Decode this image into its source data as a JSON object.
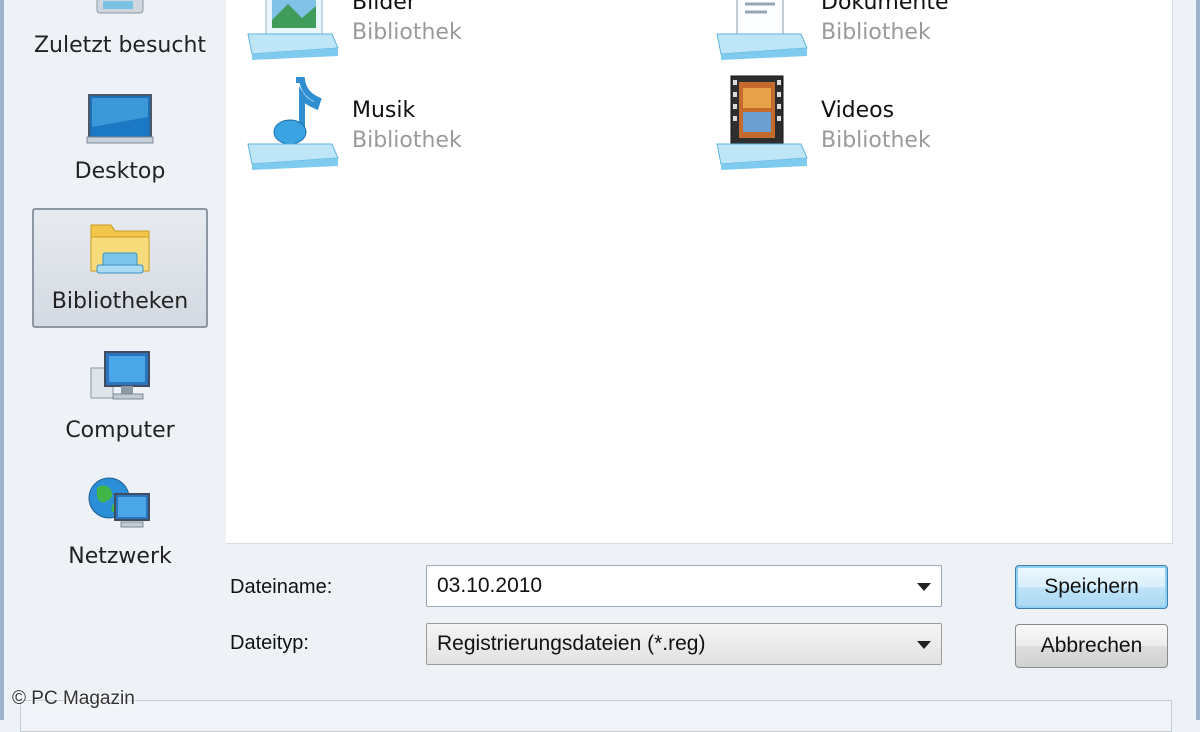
{
  "sidebar": {
    "items": [
      {
        "label": "Zuletzt besucht",
        "icon": "recent-places-icon"
      },
      {
        "label": "Desktop",
        "icon": "desktop-icon"
      },
      {
        "label": "Bibliotheken",
        "icon": "libraries-icon",
        "selected": true
      },
      {
        "label": "Computer",
        "icon": "computer-icon"
      },
      {
        "label": "Netzwerk",
        "icon": "network-icon"
      }
    ]
  },
  "libraries": [
    {
      "name": "Bilder",
      "type": "Bibliothek",
      "icon": "pictures-library-icon"
    },
    {
      "name": "Dokumente",
      "type": "Bibliothek",
      "icon": "documents-library-icon"
    },
    {
      "name": "Musik",
      "type": "Bibliothek",
      "icon": "music-library-icon"
    },
    {
      "name": "Videos",
      "type": "Bibliothek",
      "icon": "videos-library-icon"
    }
  ],
  "form": {
    "filename_label": "Dateiname:",
    "filename_value": "03.10.2010",
    "filetype_label": "Dateityp:",
    "filetype_value": "Registrierungsdateien (*.reg)"
  },
  "buttons": {
    "save": "Speichern",
    "cancel": "Abbrechen"
  },
  "watermark": "© PC Magazin",
  "colors": {
    "accent": "#3c7fb1",
    "selection": "#d4dae2",
    "subtext": "#9a9a9a"
  }
}
